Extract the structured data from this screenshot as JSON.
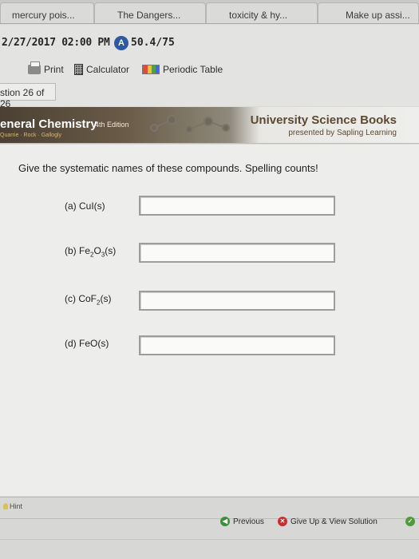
{
  "browser_tabs": [
    {
      "label": "mercury pois..."
    },
    {
      "label": "The Dangers..."
    },
    {
      "label": "toxicity & hy..."
    },
    {
      "label": "Make up assi..."
    }
  ],
  "header": {
    "due_datetime": "2/27/2017 02:00 PM",
    "score_badge": "A",
    "score": "50.4/75",
    "toolbar": {
      "print_label": "Print",
      "calculator_label": "Calculator",
      "periodic_table_label": "Periodic Table"
    },
    "question_count": "stion 26 of 26"
  },
  "banner": {
    "book_title": "eneral Chemistry",
    "edition": "4th Edition",
    "authors": "Quarrie · Rock · Gallogly",
    "publisher": "University Science Books",
    "presented_by": "presented by Sapling Learning"
  },
  "question": {
    "prompt": "Give the systematic names of these compounds. Spelling counts!",
    "parts": [
      {
        "label_pre": "(a) CuI(s)",
        "value": ""
      },
      {
        "label_pre": "(b) Fe",
        "sub1": "2",
        "mid": "O",
        "sub2": "3",
        "label_post": "(s)",
        "value": ""
      },
      {
        "label_pre": "(c) CoF",
        "sub1": "2",
        "label_post": "(s)",
        "value": ""
      },
      {
        "label_pre": "(d) FeO(s)",
        "value": ""
      }
    ]
  },
  "footer": {
    "hint_label": "Hint",
    "previous_label": "Previous",
    "give_up_label": "Give Up & View Solution"
  },
  "colors": {
    "score_badge": "#2c5aa0",
    "banner_dark": "#4b4033",
    "publisher_text": "#5c4a32",
    "previous_icon": "#3b8f3a",
    "give_up_icon": "#c62f2f"
  }
}
